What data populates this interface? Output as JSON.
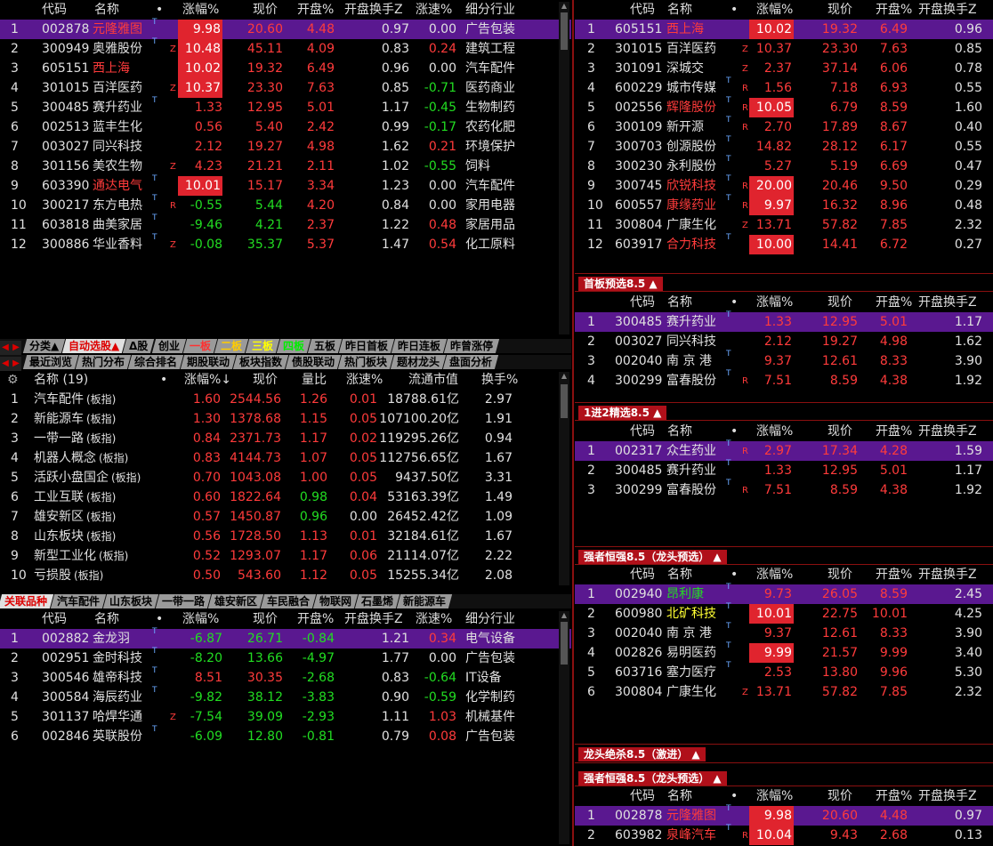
{
  "colors": {
    "accent_red": "#e0242e",
    "highlight_purple": "#5a1890",
    "up": "#ff3b3b",
    "down": "#22dd22"
  },
  "top_left": {
    "headers": [
      "代码",
      "名称",
      "•",
      "涨幅%",
      "现价",
      "开盘%",
      "开盘换手Z",
      "涨速%",
      "细分行业"
    ],
    "rows": [
      {
        "i": "1",
        "code": "002878",
        "name": "元隆雅图",
        "tag": "T",
        "mark": "",
        "chg": "9.98",
        "price": "20.60",
        "open": "4.48",
        "turn": "0.97",
        "speed": "0.00",
        "ind": "广告包装"
      },
      {
        "i": "2",
        "code": "300949",
        "name": "奥雅股份",
        "tag": "T",
        "mark": "Z",
        "chg": "10.48",
        "price": "45.11",
        "open": "4.09",
        "turn": "0.83",
        "speed": "0.24",
        "ind": "建筑工程"
      },
      {
        "i": "3",
        "code": "605151",
        "name": "西上海",
        "tag": "",
        "mark": "",
        "chg": "10.02",
        "price": "19.32",
        "open": "6.49",
        "turn": "0.96",
        "speed": "0.00",
        "ind": "汽车配件"
      },
      {
        "i": "4",
        "code": "301015",
        "name": "百洋医药",
        "tag": "",
        "mark": "Z",
        "chg": "10.37",
        "price": "23.30",
        "open": "7.63",
        "turn": "0.85",
        "speed": "-0.71",
        "ind": "医药商业"
      },
      {
        "i": "5",
        "code": "300485",
        "name": "赛升药业",
        "tag": "T",
        "mark": "",
        "chg": "1.33",
        "price": "12.95",
        "open": "5.01",
        "turn": "1.17",
        "speed": "-0.45",
        "ind": "生物制药"
      },
      {
        "i": "6",
        "code": "002513",
        "name": "蓝丰生化",
        "tag": "",
        "mark": "",
        "chg": "0.56",
        "price": "5.40",
        "open": "2.42",
        "turn": "0.99",
        "speed": "-0.17",
        "ind": "农药化肥"
      },
      {
        "i": "7",
        "code": "003027",
        "name": "同兴科技",
        "tag": "",
        "mark": "",
        "chg": "2.12",
        "price": "19.27",
        "open": "4.98",
        "turn": "1.62",
        "speed": "0.21",
        "ind": "环境保护"
      },
      {
        "i": "8",
        "code": "301156",
        "name": "美农生物",
        "tag": "",
        "mark": "Z",
        "chg": "4.23",
        "price": "21.21",
        "open": "2.11",
        "turn": "1.02",
        "speed": "-0.55",
        "ind": "饲料"
      },
      {
        "i": "9",
        "code": "603390",
        "name": "通达电气",
        "tag": "T",
        "mark": "",
        "chg": "10.01",
        "price": "15.17",
        "open": "3.34",
        "turn": "1.23",
        "speed": "0.00",
        "ind": "汽车配件"
      },
      {
        "i": "10",
        "code": "300217",
        "name": "东方电热",
        "tag": "T",
        "mark": "R",
        "chg": "-0.55",
        "price": "5.44",
        "open": "4.20",
        "turn": "0.84",
        "speed": "0.00",
        "ind": "家用电器"
      },
      {
        "i": "11",
        "code": "603818",
        "name": "曲美家居",
        "tag": "T",
        "mark": "",
        "chg": "-9.46",
        "price": "4.21",
        "open": "2.37",
        "turn": "1.22",
        "speed": "0.48",
        "ind": "家居用品"
      },
      {
        "i": "12",
        "code": "300886",
        "name": "华业香料",
        "tag": "T",
        "mark": "Z",
        "chg": "-0.08",
        "price": "35.37",
        "open": "5.37",
        "turn": "1.47",
        "speed": "0.54",
        "ind": "化工原料"
      }
    ]
  },
  "tabs1": [
    "分类▲",
    "自动选股▲",
    "Δ股",
    "创业",
    "一板",
    "二板",
    "三板",
    "四板",
    "五板",
    "昨日首板",
    "昨日连板",
    "昨曾涨停"
  ],
  "tabs2": [
    "最近浏览",
    "热门分布",
    "综合排名",
    "期股联动",
    "板块指数",
    "债股联动",
    "热门板块",
    "题材龙头",
    "盘面分析"
  ],
  "mid_left": {
    "headers": [
      "名称 (19)",
      "•",
      "涨幅%↓",
      "现价",
      "量比",
      "涨速%",
      "流通市值",
      "换手%"
    ],
    "rows": [
      {
        "i": "1",
        "name": "汽车配件",
        "sub": "(板指)",
        "chg": "1.60",
        "price": "2544.56",
        "ratio": "1.26",
        "speed": "0.01",
        "cap": "18788.61亿",
        "turn": "2.97"
      },
      {
        "i": "2",
        "name": "新能源车",
        "sub": "(板指)",
        "chg": "1.30",
        "price": "1378.68",
        "ratio": "1.15",
        "speed": "0.05",
        "cap": "107100.20亿",
        "turn": "1.91"
      },
      {
        "i": "3",
        "name": "一带一路",
        "sub": "(板指)",
        "chg": "0.84",
        "price": "2371.73",
        "ratio": "1.17",
        "speed": "0.02",
        "cap": "119295.26亿",
        "turn": "0.94"
      },
      {
        "i": "4",
        "name": "机器人概念",
        "sub": "(板指)",
        "chg": "0.83",
        "price": "4144.73",
        "ratio": "1.07",
        "speed": "0.05",
        "cap": "112756.65亿",
        "turn": "1.67"
      },
      {
        "i": "5",
        "name": "活跃小盘国企",
        "sub": "(板指)",
        "chg": "0.70",
        "price": "1043.08",
        "ratio": "1.00",
        "speed": "0.05",
        "cap": "9437.50亿",
        "turn": "3.31"
      },
      {
        "i": "6",
        "name": "工业互联",
        "sub": "(板指)",
        "chg": "0.60",
        "price": "1822.64",
        "ratio": "0.98",
        "speed": "0.04",
        "cap": "53163.39亿",
        "turn": "1.49"
      },
      {
        "i": "7",
        "name": "雄安新区",
        "sub": "(板指)",
        "chg": "0.57",
        "price": "1450.87",
        "ratio": "0.96",
        "speed": "0.00",
        "cap": "26452.42亿",
        "turn": "1.09"
      },
      {
        "i": "8",
        "name": "山东板块",
        "sub": "(板指)",
        "chg": "0.56",
        "price": "1728.50",
        "ratio": "1.13",
        "speed": "0.01",
        "cap": "32184.61亿",
        "turn": "1.67"
      },
      {
        "i": "9",
        "name": "新型工业化",
        "sub": "(板指)",
        "chg": "0.52",
        "price": "1293.07",
        "ratio": "1.17",
        "speed": "0.06",
        "cap": "21114.07亿",
        "turn": "2.22"
      },
      {
        "i": "10",
        "name": "亏损股",
        "sub": "(板指)",
        "chg": "0.50",
        "price": "543.60",
        "ratio": "1.12",
        "speed": "0.05",
        "cap": "15255.34亿",
        "turn": "2.08"
      }
    ]
  },
  "tabs3": [
    "关联品种",
    "汽车配件",
    "山东板块",
    "一带一路",
    "雄安新区",
    "车民融合",
    "物联网",
    "石墨烯",
    "新能源车"
  ],
  "bot_left": {
    "headers": [
      "代码",
      "名称",
      "•",
      "涨幅%",
      "现价",
      "开盘%",
      "开盘换手Z",
      "涨速%",
      "细分行业"
    ],
    "rows": [
      {
        "i": "1",
        "code": "002882",
        "name": "金龙羽",
        "tag": "T",
        "mark": "",
        "chg": "-6.87",
        "price": "26.71",
        "open": "-0.84",
        "turn": "1.21",
        "speed": "0.34",
        "ind": "电气设备"
      },
      {
        "i": "2",
        "code": "002951",
        "name": "金时科技",
        "tag": "T",
        "mark": "",
        "chg": "-8.20",
        "price": "13.66",
        "open": "-4.97",
        "turn": "1.77",
        "speed": "0.00",
        "ind": "广告包装"
      },
      {
        "i": "3",
        "code": "300546",
        "name": "雄帝科技",
        "tag": "T",
        "mark": "",
        "chg": "8.51",
        "price": "30.35",
        "open": "-2.68",
        "turn": "0.83",
        "speed": "-0.64",
        "ind": "IT设备"
      },
      {
        "i": "4",
        "code": "300584",
        "name": "海辰药业",
        "tag": "T",
        "mark": "",
        "chg": "-9.82",
        "price": "38.12",
        "open": "-3.83",
        "turn": "0.90",
        "speed": "-0.59",
        "ind": "化学制药"
      },
      {
        "i": "5",
        "code": "301137",
        "name": "哈焊华通",
        "tag": "",
        "mark": "Z",
        "chg": "-7.54",
        "price": "39.09",
        "open": "-2.93",
        "turn": "1.11",
        "speed": "1.03",
        "ind": "机械基件"
      },
      {
        "i": "6",
        "code": "002846",
        "name": "英联股份",
        "tag": "T",
        "mark": "",
        "chg": "-6.09",
        "price": "12.80",
        "open": "-0.81",
        "turn": "0.79",
        "speed": "0.08",
        "ind": "广告包装"
      }
    ]
  },
  "right_headers": [
    "代码",
    "名称",
    "•",
    "涨幅%",
    "现价",
    "开盘%",
    "开盘换手Z"
  ],
  "right_top": [
    {
      "i": "1",
      "code": "605151",
      "name": "西上海",
      "tag": "",
      "mark": "",
      "chg": "10.02",
      "price": "19.32",
      "open": "6.49",
      "turn": "0.96"
    },
    {
      "i": "2",
      "code": "301015",
      "name": "百洋医药",
      "tag": "",
      "mark": "Z",
      "chg": "10.37",
      "price": "23.30",
      "open": "7.63",
      "turn": "0.85"
    },
    {
      "i": "3",
      "code": "301091",
      "name": "深城交",
      "tag": "",
      "mark": "Z",
      "chg": "2.37",
      "price": "37.14",
      "open": "6.06",
      "turn": "0.78"
    },
    {
      "i": "4",
      "code": "600229",
      "name": "城市传媒",
      "tag": "T",
      "mark": "R",
      "chg": "1.56",
      "price": "7.18",
      "open": "6.93",
      "turn": "0.55"
    },
    {
      "i": "5",
      "code": "002556",
      "name": "辉隆股份",
      "tag": "T",
      "mark": "R",
      "chg": "10.05",
      "price": "6.79",
      "open": "8.59",
      "turn": "1.60"
    },
    {
      "i": "6",
      "code": "300109",
      "name": "新开源",
      "tag": "T",
      "mark": "R",
      "chg": "2.70",
      "price": "17.89",
      "open": "8.67",
      "turn": "0.40"
    },
    {
      "i": "7",
      "code": "300703",
      "name": "创源股份",
      "tag": "T",
      "mark": "",
      "chg": "14.82",
      "price": "28.12",
      "open": "6.17",
      "turn": "0.55"
    },
    {
      "i": "8",
      "code": "300230",
      "name": "永利股份",
      "tag": "T",
      "mark": "",
      "chg": "5.27",
      "price": "5.19",
      "open": "6.69",
      "turn": "0.47"
    },
    {
      "i": "9",
      "code": "300745",
      "name": "欣锐科技",
      "tag": "T",
      "mark": "R",
      "chg": "20.00",
      "price": "20.46",
      "open": "9.50",
      "turn": "0.29"
    },
    {
      "i": "10",
      "code": "600557",
      "name": "康缘药业",
      "tag": "T",
      "mark": "R",
      "chg": "9.97",
      "price": "16.32",
      "open": "8.96",
      "turn": "0.48"
    },
    {
      "i": "11",
      "code": "300804",
      "name": "广康生化",
      "tag": "",
      "mark": "Z",
      "chg": "13.71",
      "price": "57.82",
      "open": "7.85",
      "turn": "2.32"
    },
    {
      "i": "12",
      "code": "603917",
      "name": "合力科技",
      "tag": "T",
      "mark": "",
      "chg": "10.00",
      "price": "14.41",
      "open": "6.72",
      "turn": "0.27"
    }
  ],
  "sec1_title": "首板预选8.5 ▲",
  "sec1": [
    {
      "i": "1",
      "code": "300485",
      "name": "赛升药业",
      "tag": "T",
      "mark": "",
      "chg": "1.33",
      "price": "12.95",
      "open": "5.01",
      "turn": "1.17"
    },
    {
      "i": "2",
      "code": "003027",
      "name": "同兴科技",
      "tag": "",
      "mark": "",
      "chg": "2.12",
      "price": "19.27",
      "open": "4.98",
      "turn": "1.62"
    },
    {
      "i": "3",
      "code": "002040",
      "name": "南 京 港",
      "tag": "T",
      "mark": "",
      "chg": "9.37",
      "price": "12.61",
      "open": "8.33",
      "turn": "3.90"
    },
    {
      "i": "4",
      "code": "300299",
      "name": "富春股份",
      "tag": "T",
      "mark": "R",
      "chg": "7.51",
      "price": "8.59",
      "open": "4.38",
      "turn": "1.92"
    }
  ],
  "sec2_title": "1进2精选8.5 ▲",
  "sec2": [
    {
      "i": "1",
      "code": "002317",
      "name": "众生药业",
      "tag": "T",
      "mark": "R",
      "chg": "2.97",
      "price": "17.34",
      "open": "4.28",
      "turn": "1.59"
    },
    {
      "i": "2",
      "code": "300485",
      "name": "赛升药业",
      "tag": "T",
      "mark": "",
      "chg": "1.33",
      "price": "12.95",
      "open": "5.01",
      "turn": "1.17"
    },
    {
      "i": "3",
      "code": "300299",
      "name": "富春股份",
      "tag": "T",
      "mark": "R",
      "chg": "7.51",
      "price": "8.59",
      "open": "4.38",
      "turn": "1.92"
    }
  ],
  "sec3_title": "强者恒强8.5（龙头预选） ▲",
  "sec3": [
    {
      "i": "1",
      "code": "002940",
      "name": "昂利康",
      "tag": "T",
      "mark": "",
      "chg": "9.73",
      "price": "26.05",
      "open": "8.59",
      "turn": "2.45"
    },
    {
      "i": "2",
      "code": "600980",
      "name": "北矿科技",
      "tag": "T",
      "mark": "",
      "chg": "10.01",
      "price": "22.75",
      "open": "10.01",
      "turn": "4.25"
    },
    {
      "i": "3",
      "code": "002040",
      "name": "南 京 港",
      "tag": "T",
      "mark": "",
      "chg": "9.37",
      "price": "12.61",
      "open": "8.33",
      "turn": "3.90"
    },
    {
      "i": "4",
      "code": "002826",
      "name": "易明医药",
      "tag": "T",
      "mark": "",
      "chg": "9.99",
      "price": "21.57",
      "open": "9.99",
      "turn": "3.40"
    },
    {
      "i": "5",
      "code": "603716",
      "name": "塞力医疗",
      "tag": "T",
      "mark": "",
      "chg": "2.53",
      "price": "13.80",
      "open": "9.96",
      "turn": "5.30"
    },
    {
      "i": "6",
      "code": "300804",
      "name": "广康生化",
      "tag": "",
      "mark": "Z",
      "chg": "13.71",
      "price": "57.82",
      "open": "7.85",
      "turn": "2.32"
    }
  ],
  "sec4_title": "龙头绝杀8.5（激进） ▲",
  "sec5_title": "强者恒强8.5（龙头预选） ▲",
  "sec5": [
    {
      "i": "1",
      "code": "002878",
      "name": "元隆雅图",
      "tag": "T",
      "mark": "",
      "chg": "9.98",
      "price": "20.60",
      "open": "4.48",
      "turn": "0.97"
    },
    {
      "i": "2",
      "code": "603982",
      "name": "泉峰汽车",
      "tag": "T",
      "mark": "R",
      "chg": "10.04",
      "price": "9.43",
      "open": "2.68",
      "turn": "0.13"
    }
  ]
}
